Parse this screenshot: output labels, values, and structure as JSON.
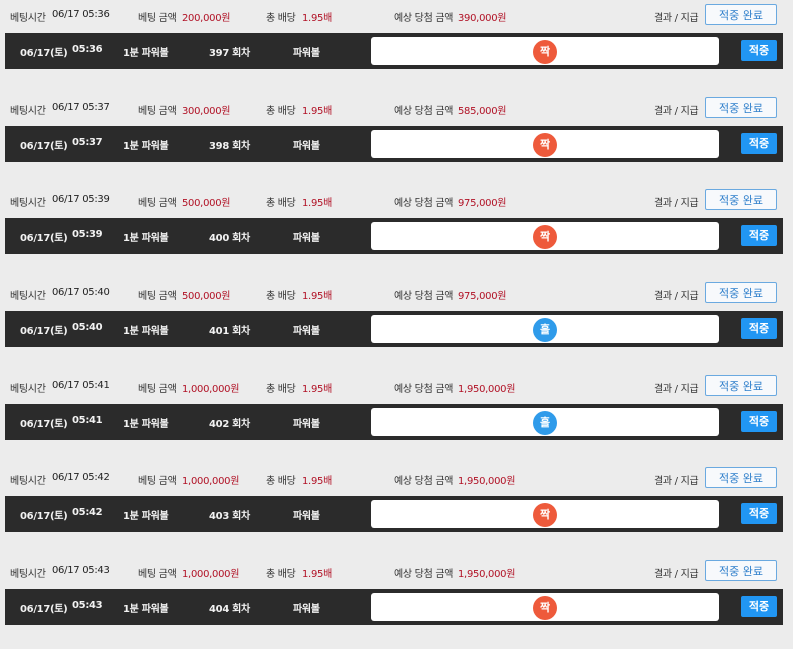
{
  "labels": {
    "bet_time": "베팅시간",
    "bet_amount": "베팅 금액",
    "total_odds": "총 배당",
    "expected_win": "예상 당첨 금액",
    "result_pay": "결과 / 지급",
    "done_button": "적중 완료",
    "hit_button": "적중"
  },
  "colors": {
    "odd_ball": "#ee5a3b",
    "even_ball": "#2f9bea",
    "accent_red": "#b11226",
    "hit_button": "#2196f3"
  },
  "bets": [
    {
      "bet_time": "06/17 05:36",
      "amount": "200,000원",
      "odds": "1.95배",
      "expected": "390,000원",
      "date": "06/17(토)",
      "time": "05:36",
      "game": "1분 파워볼",
      "round": "397 회차",
      "type": "파워볼",
      "result": "짝",
      "result_kind": "odd"
    },
    {
      "bet_time": "06/17 05:37",
      "amount": "300,000원",
      "odds": "1.95배",
      "expected": "585,000원",
      "date": "06/17(토)",
      "time": "05:37",
      "game": "1분 파워볼",
      "round": "398 회차",
      "type": "파워볼",
      "result": "짝",
      "result_kind": "odd"
    },
    {
      "bet_time": "06/17 05:39",
      "amount": "500,000원",
      "odds": "1.95배",
      "expected": "975,000원",
      "date": "06/17(토)",
      "time": "05:39",
      "game": "1분 파워볼",
      "round": "400 회차",
      "type": "파워볼",
      "result": "짝",
      "result_kind": "odd"
    },
    {
      "bet_time": "06/17 05:40",
      "amount": "500,000원",
      "odds": "1.95배",
      "expected": "975,000원",
      "date": "06/17(토)",
      "time": "05:40",
      "game": "1분 파워볼",
      "round": "401 회차",
      "type": "파워볼",
      "result": "홀",
      "result_kind": "even"
    },
    {
      "bet_time": "06/17 05:41",
      "amount": "1,000,000원",
      "odds": "1.95배",
      "expected": "1,950,000원",
      "date": "06/17(토)",
      "time": "05:41",
      "game": "1분 파워볼",
      "round": "402 회차",
      "type": "파워볼",
      "result": "홀",
      "result_kind": "even"
    },
    {
      "bet_time": "06/17 05:42",
      "amount": "1,000,000원",
      "odds": "1.95배",
      "expected": "1,950,000원",
      "date": "06/17(토)",
      "time": "05:42",
      "game": "1분 파워볼",
      "round": "403 회차",
      "type": "파워볼",
      "result": "짝",
      "result_kind": "odd"
    },
    {
      "bet_time": "06/17 05:43",
      "amount": "1,000,000원",
      "odds": "1.95배",
      "expected": "1,950,000원",
      "date": "06/17(토)",
      "time": "05:43",
      "game": "1분 파워볼",
      "round": "404 회차",
      "type": "파워볼",
      "result": "짝",
      "result_kind": "odd"
    }
  ]
}
